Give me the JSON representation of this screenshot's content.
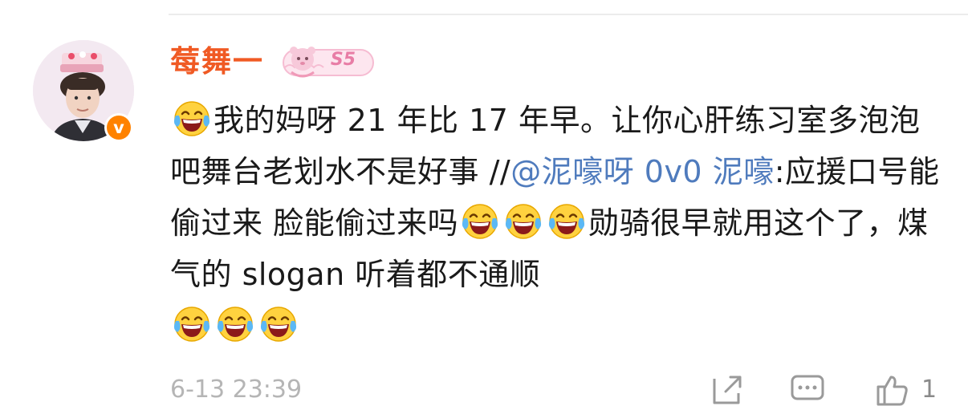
{
  "comment": {
    "user": {
      "name": "莓舞一",
      "badge_text": "S5",
      "avatar_icon": "avatar-photo",
      "verified_mark": "v",
      "verified_color": "#ff8200",
      "name_color": "#f05a24"
    },
    "text_parts": {
      "p1": "我的妈呀 21 年比 17 年早。让你心肝练习室多泡泡吧舞台老划水不是好事 //",
      "mention": "@泥嚎呀 0v0 泥嚎",
      "p2": ":应援口号能偷过来 脸能偷过来吗",
      "p3": "勋骑很早就用这个了，煤气的 slogan 听着都不通顺"
    },
    "emoji_icon": "laugh-cry-emoji",
    "mention_color": "#4f7bbd",
    "footer": {
      "time": "6-13 23:39",
      "share_icon": "share-icon",
      "comment_icon": "comment-icon",
      "like_icon": "thumbs-up-icon",
      "like_count": "1"
    }
  }
}
